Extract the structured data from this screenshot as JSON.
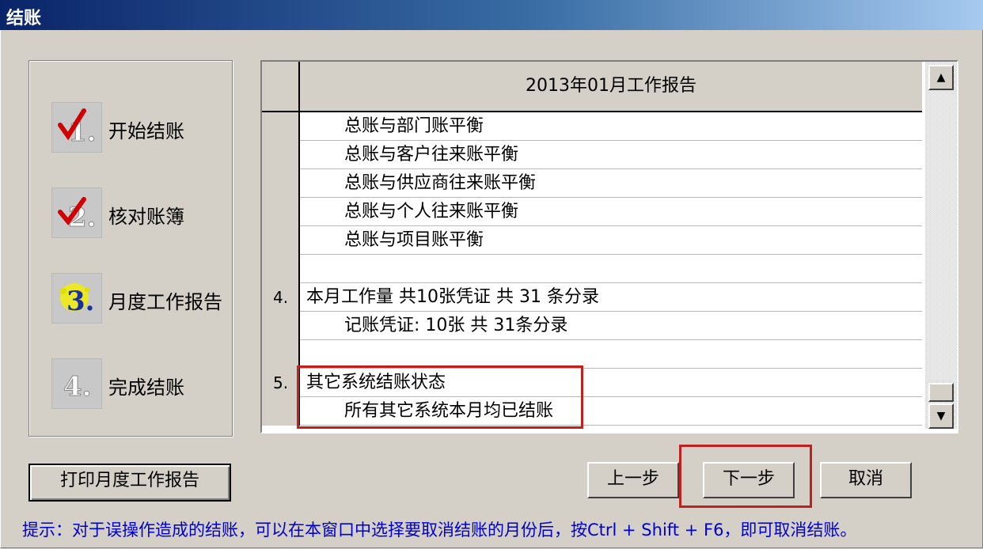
{
  "window": {
    "title": "结账"
  },
  "steps": [
    {
      "label": "开始结账",
      "icon": "check-step-1-icon"
    },
    {
      "label": "核对账簿",
      "icon": "check-step-2-icon"
    },
    {
      "label": "月度工作报告",
      "icon": "report-step-3-icon"
    },
    {
      "label": "完成结账",
      "icon": "step-4-icon"
    }
  ],
  "report": {
    "title": "2013年01月工作报告",
    "rows": [
      {
        "num": "",
        "text": "总账与部门账平衡",
        "indent": true
      },
      {
        "num": "",
        "text": "总账与客户往来账平衡",
        "indent": true
      },
      {
        "num": "",
        "text": "总账与供应商往来账平衡",
        "indent": true
      },
      {
        "num": "",
        "text": "总账与个人往来账平衡",
        "indent": true
      },
      {
        "num": "",
        "text": "总账与项目账平衡",
        "indent": true
      },
      {
        "num": "",
        "text": "",
        "indent": false
      },
      {
        "num": "4.",
        "text": "本月工作量 共10张凭证 共 31 条分录",
        "indent": false
      },
      {
        "num": "",
        "text": "记账凭证: 10张   共  31条分录",
        "indent": true
      },
      {
        "num": "",
        "text": "",
        "indent": false
      },
      {
        "num": "5.",
        "text": "其它系统结账状态",
        "indent": false
      },
      {
        "num": "",
        "text": "所有其它系统本月均已结账",
        "indent": true
      }
    ]
  },
  "buttons": {
    "print": "打印月度工作报告",
    "prev": "上一步",
    "next": "下一步",
    "cancel": "取消"
  },
  "hint": "提示：对于误操作造成的结账，可以在本窗口中选择要取消结账的月份后，按Ctrl + Shift + F6，即可取消结账。",
  "colors": {
    "title_bar": "#0a246a",
    "highlight": "#c0201e",
    "hint_text": "#0000cc"
  }
}
